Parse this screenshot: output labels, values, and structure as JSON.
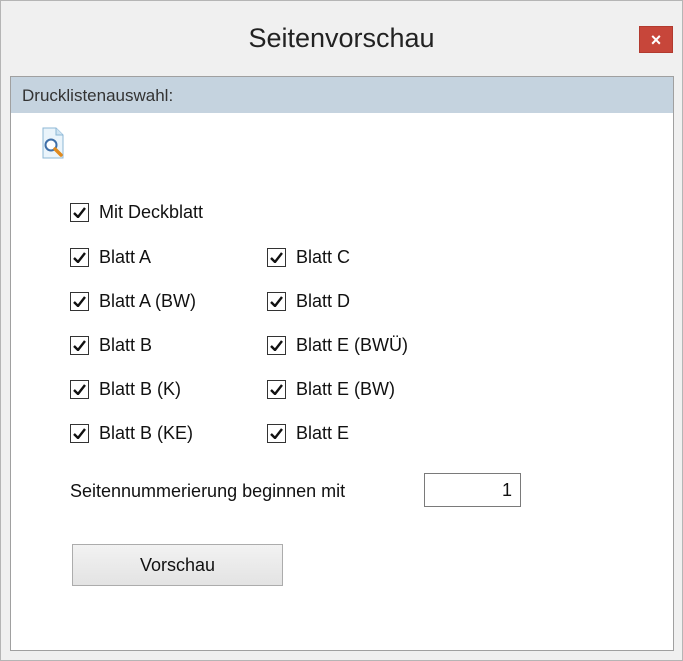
{
  "window": {
    "title": "Seitenvorschau",
    "close_label": "×"
  },
  "group": {
    "header": "Drucklistenauswahl:"
  },
  "options": {
    "deckblatt": {
      "label": "Mit Deckblatt",
      "checked": true
    },
    "left": [
      {
        "label": "Blatt A",
        "checked": true
      },
      {
        "label": "Blatt A (BW)",
        "checked": true
      },
      {
        "label": "Blatt B",
        "checked": true
      },
      {
        "label": "Blatt B (K)",
        "checked": true
      },
      {
        "label": "Blatt B (KE)",
        "checked": true
      }
    ],
    "right": [
      {
        "label": "Blatt C",
        "checked": true
      },
      {
        "label": "Blatt D",
        "checked": true
      },
      {
        "label": "Blatt E (BWÜ)",
        "checked": true
      },
      {
        "label": "Blatt E (BW)",
        "checked": true
      },
      {
        "label": "Blatt E",
        "checked": true
      }
    ]
  },
  "numbering": {
    "label": "Seitennummerierung beginnen mit",
    "value": "1"
  },
  "actions": {
    "preview_label": "Vorschau"
  },
  "colors": {
    "close_button": "#c7463a",
    "group_header": "#c5d3df"
  }
}
